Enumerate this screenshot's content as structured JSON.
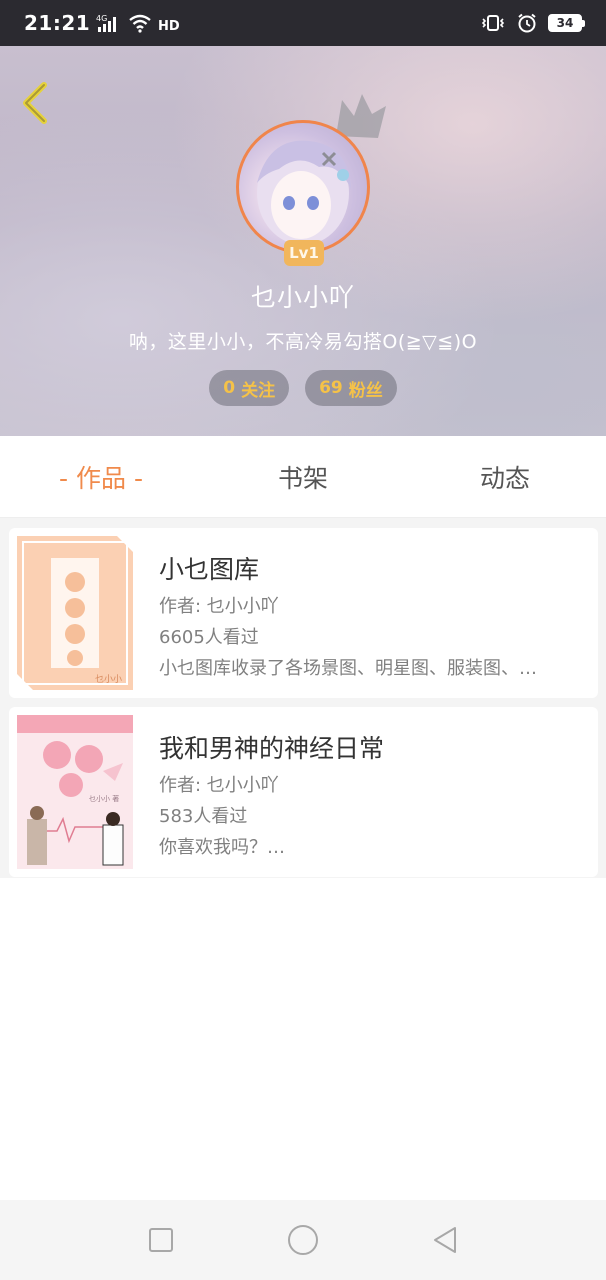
{
  "status_bar": {
    "time": "21:21",
    "network": "4G",
    "hd": "HD",
    "battery": "34",
    "icons": [
      "signal-icon",
      "wifi-icon",
      "vibrate-icon",
      "alarm-icon",
      "battery-icon"
    ]
  },
  "profile": {
    "username": "乜小小吖",
    "bio": "呐，这里小小，不高冷易勾搭O(≧▽≦)O",
    "level": "Lv1",
    "following_count": "0",
    "following_label": "关注",
    "fans_count": "69",
    "fans_label": "粉丝"
  },
  "tabs": [
    {
      "label": "- 作品 -",
      "active": true
    },
    {
      "label": "书架",
      "active": false
    },
    {
      "label": "动态",
      "active": false
    }
  ],
  "works": [
    {
      "title": "小乜图库",
      "author": "作者: 乜小小吖",
      "views": "6605人看过",
      "description": "小乜图库收录了各场景图、明星图、服装图、…",
      "cover_text": "乜小小"
    },
    {
      "title": "我和男神的神经日常",
      "author": "作者: 乜小小吖",
      "views": "583人看过",
      "description": "你喜欢我吗？…",
      "cover_text": "乜小小 著"
    }
  ],
  "colors": {
    "accent": "#f08a4b",
    "stat_text": "#f5c248",
    "level_badge": "#f1b65c",
    "status_bar": "#2b2a30"
  }
}
